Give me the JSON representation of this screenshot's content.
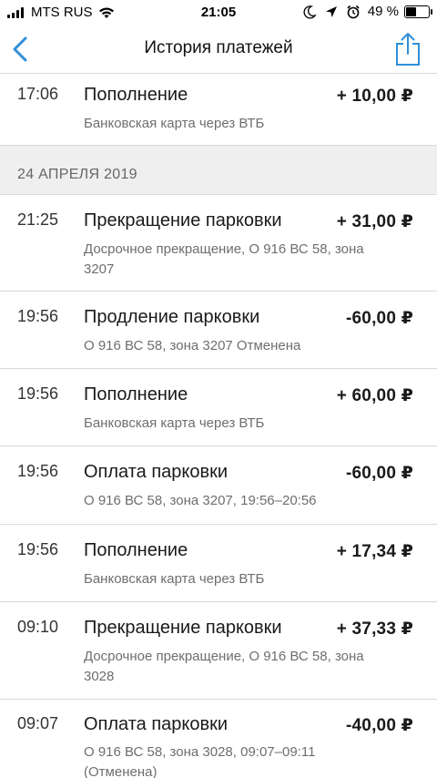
{
  "status_bar": {
    "carrier": "MTS RUS",
    "time": "21:05",
    "battery_percent": "49 %",
    "battery_level": 0.49,
    "icons": [
      "signal-icon",
      "wifi-icon",
      "moon-icon",
      "location-arrow-icon",
      "alarm-icon",
      "battery-icon"
    ]
  },
  "nav": {
    "title": "История платежей",
    "back_icon": "chevron-left-icon",
    "share_icon": "share-icon",
    "accent_color": "#2f8fd8"
  },
  "top_item": {
    "time": "17:06",
    "title": "Пополнение",
    "amount": "+ 10,00 ₽",
    "subtitle": "Банковская карта через ВТБ"
  },
  "date_header": "24 АПРЕЛЯ 2019",
  "items": [
    {
      "time": "21:25",
      "title": "Прекращение парковки",
      "amount": "+ 31,00 ₽",
      "subtitle": "Досрочное прекращение, О 916 ВС 58, зона 3207"
    },
    {
      "time": "19:56",
      "title": "Продление парковки",
      "amount": "-60,00 ₽",
      "subtitle": "О 916 ВС 58, зона 3207 Отменена"
    },
    {
      "time": "19:56",
      "title": "Пополнение",
      "amount": "+ 60,00 ₽",
      "subtitle": "Банковская карта через ВТБ"
    },
    {
      "time": "19:56",
      "title": "Оплата парковки",
      "amount": "-60,00 ₽",
      "subtitle": "О 916 ВС 58, зона 3207, 19:56–20:56"
    },
    {
      "time": "19:56",
      "title": "Пополнение",
      "amount": "+ 17,34 ₽",
      "subtitle": "Банковская карта через ВТБ"
    },
    {
      "time": "09:10",
      "title": "Прекращение парковки",
      "amount": "+ 37,33 ₽",
      "subtitle": "Досрочное прекращение, О 916 ВС 58, зона 3028"
    },
    {
      "time": "09:07",
      "title": "Оплата парковки",
      "amount": "-40,00 ₽",
      "subtitle": "О 916 ВС 58, зона 3028, 09:07–09:11 (Отменена)"
    }
  ]
}
